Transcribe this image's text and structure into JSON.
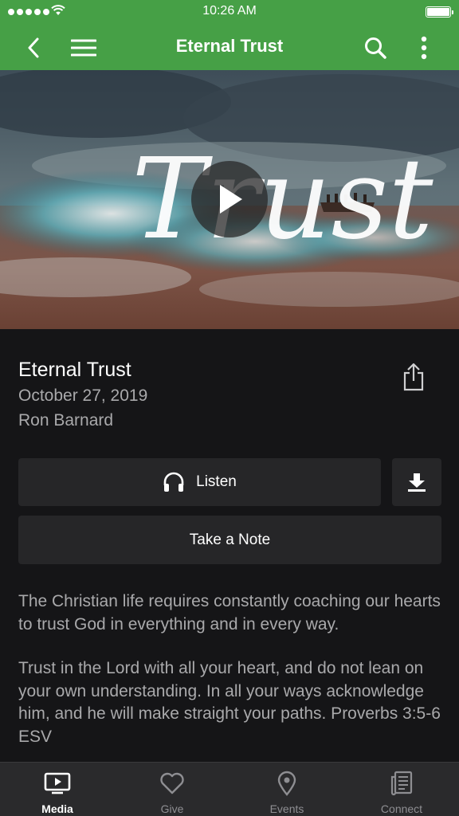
{
  "status_bar": {
    "time": "10:26 AM"
  },
  "nav": {
    "title": "Eternal Trust",
    "back_icon": "chevron-left-icon",
    "menu_icon": "hamburger-menu-icon",
    "search_icon": "search-icon",
    "more_icon": "more-vertical-icon"
  },
  "hero": {
    "artwork_word": "Trust"
  },
  "sermon": {
    "title": "Eternal Trust",
    "date": "October 27, 2019",
    "speaker": "Ron Barnard"
  },
  "actions": {
    "listen_label": "Listen",
    "note_label": "Take a Note"
  },
  "description": {
    "paragraph_1": "The Christian life requires constantly coaching our hearts to trust God in everything and in every way.",
    "paragraph_2": "Trust in the Lord with all your heart, and do not lean on your own understanding. In all your ways acknowledge him, and he will make straight your paths. Proverbs 3:5-6 ESV"
  },
  "tabs": [
    {
      "label": "Media",
      "icon": "tv-play-icon",
      "active": true
    },
    {
      "label": "Give",
      "icon": "heart-icon",
      "active": false
    },
    {
      "label": "Events",
      "icon": "map-pin-icon",
      "active": false
    },
    {
      "label": "Connect",
      "icon": "news-icon",
      "active": false
    }
  ],
  "colors": {
    "accent": "#46a046",
    "background": "#151517",
    "button": "#262628",
    "tabbar": "#2a2a2c",
    "muted_text": "#a9a9ab"
  }
}
